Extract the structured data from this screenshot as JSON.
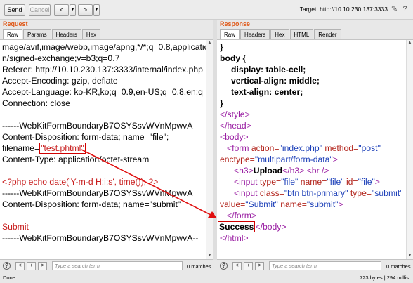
{
  "toolbar": {
    "send": "Send",
    "cancel": "Cancel",
    "back": "<",
    "forward": ">",
    "target": "Target: http://10.10.230.137:3333"
  },
  "request": {
    "title": "Request",
    "tabs": [
      "Raw",
      "Params",
      "Headers",
      "Hex"
    ],
    "lines": [
      "mage/avif,image/webp,image/apng,*/*;q=0.8,applicatio",
      "n/signed-exchange;v=b3;q=0.7",
      "Referer: http://10.10.230.137:3333/internal/index.php",
      "Accept-Encoding: gzip, deflate",
      "Accept-Language: ko-KR,ko;q=0.9,en-US;q=0.8,en;q=0.7",
      "Connection: close",
      "",
      "------WebKitFormBoundaryB7OSYSsvWVnMpwvA",
      "Content-Disposition: form-data; name=\"file\";",
      "",
      "Content-Type: application/octet-stream",
      "",
      "",
      "------WebKitFormBoundaryB7OSYSsvWVnMpwvA",
      "Content-Disposition: form-data; name=\"submit\"",
      "",
      "Submit",
      "------WebKitFormBoundaryB7OSYSsvWVnMpwvA--"
    ],
    "filename_label": "filename=",
    "filename_value": "\"test.phtml\"",
    "php_code": "<?php echo date('Y-m-d H:i:s', time()); ?>",
    "search_placeholder": "Type a search term",
    "matches": "0 matches"
  },
  "response": {
    "title": "Response",
    "tabs": [
      "Raw",
      "Headers",
      "Hex",
      "HTML",
      "Render"
    ],
    "l1": "}",
    "l2": "body {",
    "l3": "display: table-cell;",
    "l4": "vertical-align: middle;",
    "l5": "text-align: center;",
    "l6": "}",
    "l7": "</style>",
    "l8": "</head>",
    "l9": "<body>",
    "form_open": "<form",
    "form_attr1": " action=",
    "form_val1": "\"index.php\"",
    "form_attr2": " method=",
    "form_val2": "\"post\"",
    "form_attr3": "enctype=",
    "form_val3": "\"multipart/form-data\"",
    "form_close_bracket": ">",
    "h3_open": "<h3>",
    "h3_text": "Upload",
    "h3_close": "</h3>",
    "br": "<br />",
    "input1_open": "<input",
    "input1_a1": " type=",
    "input1_v1": "\"file\"",
    "input1_a2": " name=",
    "input1_v2": "\"file\"",
    "input1_a3": " id=",
    "input1_v3": "\"file\"",
    "input1_end": ">",
    "input2_open": "<input",
    "input2_a1": " class=",
    "input2_v1": "\"btn btn-primary\"",
    "input2_a2": " type=",
    "input2_v2": "\"submit\"",
    "input2_value_attr": "value=",
    "input2_v3": "\"Submit\"",
    "input2_a4": " name=",
    "input2_v4": "\"submit\"",
    "input2_end": ">",
    "form_end": "</form>",
    "success": "Success",
    "body_close": "</body>",
    "html_close": "</html>",
    "search_placeholder": "Type a search term",
    "matches": "0 matches"
  },
  "status": {
    "done": "Done",
    "info": "723 bytes | 294 millis"
  }
}
